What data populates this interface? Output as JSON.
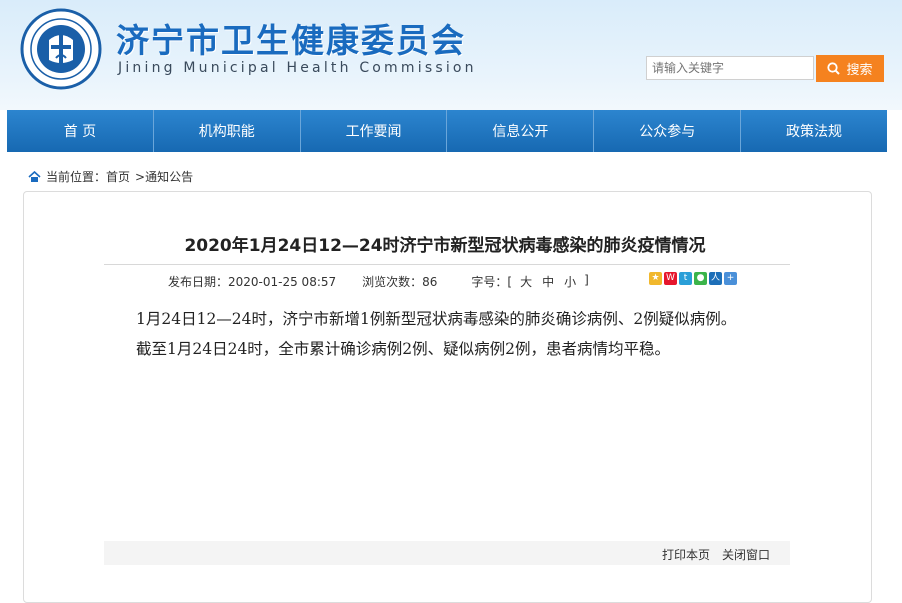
{
  "header": {
    "title": "济宁市卫生健康委员会",
    "subtitle": "Jining Municipal Health Commission",
    "search_placeholder": "请输入关键字",
    "search_button": "搜索"
  },
  "nav": {
    "items": [
      {
        "label": "首 页"
      },
      {
        "label": "机构职能"
      },
      {
        "label": "工作要闻"
      },
      {
        "label": "信息公开"
      },
      {
        "label": "公众参与"
      },
      {
        "label": "政策法规"
      }
    ]
  },
  "breadcrumb": {
    "prefix": "当前位置：",
    "home": "首页",
    "current": ">通知公告"
  },
  "article": {
    "title": "2020年1月24日12—24时济宁市新型冠状病毒感染的肺炎疫情情况",
    "publish_label": "发布日期：2020-01-25 08:57",
    "views_label": "浏览次数：86",
    "fontsize_label": "字号：[",
    "size_large": "大",
    "size_medium": "中",
    "size_small": "小",
    "fontsize_close": "]",
    "paragraphs": [
      "1月24日12—24时，济宁市新增1例新型冠状病毒感染的肺炎确诊病例、2例疑似病例。",
      "截至1月24日24时，全市累计确诊病例2例、疑似病例2例，患者病情均平稳。"
    ]
  },
  "footer": {
    "print": "打印本页",
    "close": "关闭窗口"
  },
  "colors": {
    "brand_blue": "#1a6bbf",
    "nav_blue": "#1f74bd",
    "search_orange": "#f5821f"
  }
}
